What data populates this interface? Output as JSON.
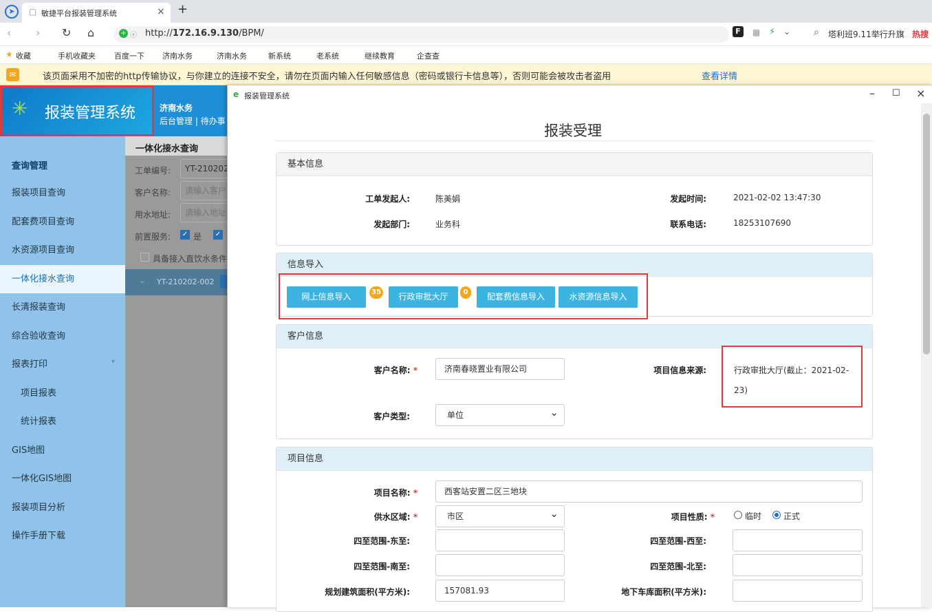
{
  "browser": {
    "tab_title": "敏捷平台报装管理系统",
    "url_prefix": "http://",
    "url_host": "172.16.9.130",
    "url_path": "/BPM/",
    "search_text": "塔利班9.11举行升旗",
    "hot_label": "热搜",
    "bookmarks": [
      "收藏",
      "手机收藏夹",
      "百度一下",
      "济南水务",
      "济南水务",
      "新系统",
      "老系统",
      "继续教育",
      "企查查"
    ],
    "warning": "该页面采用不加密的http传输协议，与你建立的连接不安全，请勿在页面内输入任何敏感信息（密码或银行卡信息等），否则可能会被攻击者盗用",
    "warning_link": "查看详情"
  },
  "app": {
    "logo_title": "报装管理系统",
    "header_org": "济南水务",
    "header_nav": "后台管理 | 待办事",
    "sidebar": {
      "section": "查询管理",
      "items": [
        "报装项目查询",
        "配套费项目查询",
        "水资源项目查询",
        "一体化接水查询",
        "长清报装查询",
        "综合验收查询",
        "报表打印",
        "项目报表",
        "统计报表",
        "GIS地图",
        "一体化GIS地图",
        "报装项目分析",
        "操作手册下载"
      ]
    },
    "query": {
      "title": "一体化接水查询",
      "order_label": "工单编号:",
      "order_value": "YT-210202",
      "customer_label": "客户名称:",
      "customer_placeholder": "请输入客户",
      "address_label": "用水地址:",
      "address_placeholder": "请输入地址",
      "pre_service_label": "前置服务:",
      "yes_label": "是",
      "direct_label": "具备接入直饮水条件",
      "row_value": "YT-210202-002"
    }
  },
  "modal": {
    "window_title": "报装管理系统",
    "heading": "报装受理",
    "basic": {
      "title": "基本信息",
      "initiator_label": "工单发起人:",
      "initiator": "陈美娟",
      "time_label": "发起时间:",
      "time": "2021-02-02 13:47:30",
      "dept_label": "发起部门:",
      "dept": "业务科",
      "phone_label": "联系电话:",
      "phone": "18253107690"
    },
    "import": {
      "title": "信息导入",
      "btn_online": "网上信息导入",
      "badge_online": "35",
      "btn_admin": "行政审批大厅",
      "badge_admin": "0",
      "btn_fee": "配套费信息导入",
      "btn_water": "水资源信息导入"
    },
    "customer": {
      "title": "客户信息",
      "name_label": "客户名称:",
      "name": "济南春晓置业有限公司",
      "source_label": "项目信息来源:",
      "source_line1": "行政审批大厅(截止：2021-02-",
      "source_line2": "23)",
      "type_label": "客户类型:",
      "type": "单位"
    },
    "project": {
      "title": "项目信息",
      "name_label": "项目名称:",
      "name": "西客站安置二区三地块",
      "area_label": "供水区域:",
      "area": "市区",
      "nature_label": "项目性质:",
      "nature_temp": "临时",
      "nature_formal": "正式",
      "east_label": "四至范围-东至:",
      "west_label": "四至范围-西至:",
      "south_label": "四至范围-南至:",
      "north_label": "四至范围-北至:",
      "build_area_label": "规划建筑面积(平方米):",
      "build_area": "157081.93",
      "garage_label": "地下车库面积(平方米):"
    }
  }
}
